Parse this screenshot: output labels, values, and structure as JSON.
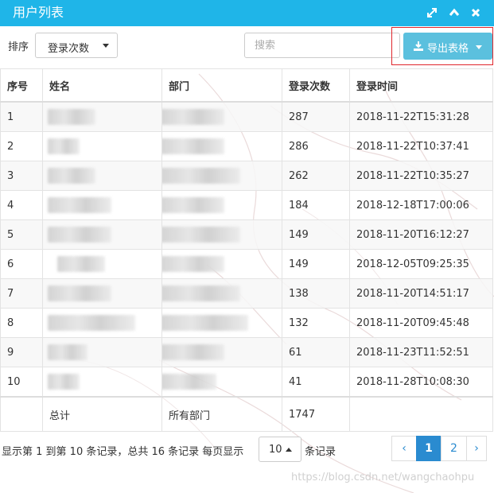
{
  "window": {
    "title": "用户列表",
    "controls": [
      "expand-icon",
      "collapse-icon",
      "close-icon"
    ]
  },
  "toolbar": {
    "sort_label": "排序",
    "sort_selected": "登录次数",
    "search_placeholder": "搜索",
    "export_label": "导出表格"
  },
  "table": {
    "headers": {
      "no": "序号",
      "name": "姓名",
      "dept": "部门",
      "count": "登录次数",
      "time": "登录时间"
    },
    "rows": [
      {
        "no": "1",
        "count": "287",
        "time": "2018-11-22T15:31:28"
      },
      {
        "no": "2",
        "count": "286",
        "time": "2018-11-22T10:37:41"
      },
      {
        "no": "3",
        "count": "262",
        "time": "2018-11-22T10:35:27"
      },
      {
        "no": "4",
        "count": "184",
        "time": "2018-12-18T17:00:06"
      },
      {
        "no": "5",
        "count": "149",
        "time": "2018-11-20T16:12:27"
      },
      {
        "no": "6",
        "count": "149",
        "time": "2018-12-05T09:25:35"
      },
      {
        "no": "7",
        "count": "138",
        "time": "2018-11-20T14:51:17"
      },
      {
        "no": "8",
        "count": "132",
        "time": "2018-11-20T09:45:48"
      },
      {
        "no": "9",
        "count": "61",
        "time": "2018-11-23T11:52:51"
      },
      {
        "no": "10",
        "count": "41",
        "time": "2018-11-28T10:08:30"
      }
    ],
    "total": {
      "name": "总计",
      "dept": "所有部门",
      "count": "1747"
    }
  },
  "footer": {
    "info": "显示第 1 到第 10 条记录，总共 16 条记录 每页显示",
    "page_size": "10",
    "info_suffix": "条记录",
    "pages": [
      "‹",
      "1",
      "2",
      "›"
    ],
    "active_page": "1"
  },
  "watermark": "https://blog.csdn.net/wangchaohpu",
  "colors": {
    "titlebar": "#1fb5e8",
    "export_button": "#5bc0de",
    "pager_active": "#2a8bd0",
    "highlight_frame": "#e0262b"
  }
}
